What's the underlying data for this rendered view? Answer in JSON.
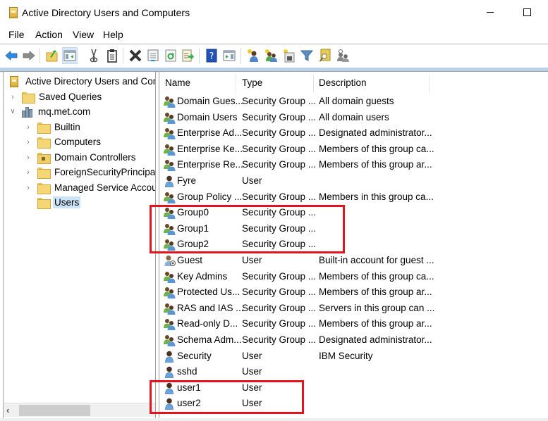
{
  "window": {
    "title": "Active Directory Users and Computers",
    "controls": [
      "minimize",
      "maximize"
    ]
  },
  "menu": [
    "File",
    "Action",
    "View",
    "Help"
  ],
  "toolbar": {
    "buttons": [
      {
        "icon": "back-arrow-icon"
      },
      {
        "icon": "forward-arrow-icon"
      },
      {
        "icon": "up-folder-icon"
      },
      {
        "icon": "show-console-tree-icon",
        "active": true
      },
      {
        "icon": "cut-icon"
      },
      {
        "icon": "paste-icon"
      },
      {
        "icon": "delete-icon"
      },
      {
        "icon": "properties-icon"
      },
      {
        "icon": "refresh-icon"
      },
      {
        "icon": "export-list-icon"
      },
      {
        "icon": "help-icon"
      },
      {
        "icon": "show-action-pane-icon"
      },
      {
        "icon": "new-user-icon"
      },
      {
        "icon": "new-group-icon"
      },
      {
        "icon": "new-ou-icon"
      },
      {
        "icon": "filter-icon"
      },
      {
        "icon": "find-icon"
      },
      {
        "icon": "add-to-group-icon"
      }
    ]
  },
  "tree": {
    "root": "Active Directory Users and Computers",
    "items": [
      {
        "label": "Saved Queries",
        "level": 1,
        "expander": "collapsed",
        "icon": "folder"
      },
      {
        "label": "mq.met.com",
        "level": 1,
        "expander": "expanded",
        "icon": "domain"
      },
      {
        "label": "Builtin",
        "level": 2,
        "expander": "collapsed",
        "icon": "folder"
      },
      {
        "label": "Computers",
        "level": 2,
        "expander": "collapsed",
        "icon": "folder"
      },
      {
        "label": "Domain Controllers",
        "level": 2,
        "expander": "collapsed",
        "icon": "dc-folder"
      },
      {
        "label": "ForeignSecurityPrincipals",
        "level": 2,
        "expander": "collapsed",
        "icon": "folder"
      },
      {
        "label": "Managed Service Accounts",
        "level": 2,
        "expander": "collapsed",
        "icon": "folder"
      },
      {
        "label": "Users",
        "level": 2,
        "expander": "none",
        "icon": "folder",
        "selected": true
      }
    ]
  },
  "list": {
    "columns": [
      "Name",
      "Type",
      "Description"
    ],
    "rows": [
      {
        "name": "Domain Gues...",
        "type": "Security Group ...",
        "description": "All domain guests",
        "kind": "group"
      },
      {
        "name": "Domain Users",
        "type": "Security Group ...",
        "description": "All domain users",
        "kind": "group"
      },
      {
        "name": "Enterprise Ad...",
        "type": "Security Group ...",
        "description": "Designated administrator...",
        "kind": "group"
      },
      {
        "name": "Enterprise Ke...",
        "type": "Security Group ...",
        "description": "Members of this group ca...",
        "kind": "group"
      },
      {
        "name": "Enterprise Re...",
        "type": "Security Group ...",
        "description": "Members of this group ar...",
        "kind": "group"
      },
      {
        "name": "Fyre",
        "type": "User",
        "description": "",
        "kind": "user"
      },
      {
        "name": "Group Policy ...",
        "type": "Security Group ...",
        "description": "Members in this group ca...",
        "kind": "group"
      },
      {
        "name": "Group0",
        "type": "Security Group ...",
        "description": "",
        "kind": "group"
      },
      {
        "name": "Group1",
        "type": "Security Group ...",
        "description": "",
        "kind": "group"
      },
      {
        "name": "Group2",
        "type": "Security Group ...",
        "description": "",
        "kind": "group"
      },
      {
        "name": "Guest",
        "type": "User",
        "description": "Built-in account for guest ...",
        "kind": "guest"
      },
      {
        "name": "Key Admins",
        "type": "Security Group ...",
        "description": "Members of this group ca...",
        "kind": "group"
      },
      {
        "name": "Protected Us...",
        "type": "Security Group ...",
        "description": "Members of this group ar...",
        "kind": "group"
      },
      {
        "name": "RAS and IAS ...",
        "type": "Security Group ...",
        "description": "Servers in this group can ...",
        "kind": "group"
      },
      {
        "name": "Read-only D...",
        "type": "Security Group ...",
        "description": "Members of this group ar...",
        "kind": "group"
      },
      {
        "name": "Schema Adm...",
        "type": "Security Group ...",
        "description": "Designated administrator...",
        "kind": "group"
      },
      {
        "name": "Security",
        "type": "User",
        "description": "IBM Security",
        "kind": "user"
      },
      {
        "name": "sshd",
        "type": "User",
        "description": "",
        "kind": "user"
      },
      {
        "name": "user1",
        "type": "User",
        "description": "",
        "kind": "user"
      },
      {
        "name": "user2",
        "type": "User",
        "description": "",
        "kind": "user"
      }
    ]
  },
  "annotations": {
    "highlight_color": "#e4141e",
    "boxes": [
      {
        "covers": [
          "Group0",
          "Group1",
          "Group2"
        ]
      },
      {
        "covers": [
          "user1",
          "user2"
        ]
      }
    ]
  }
}
